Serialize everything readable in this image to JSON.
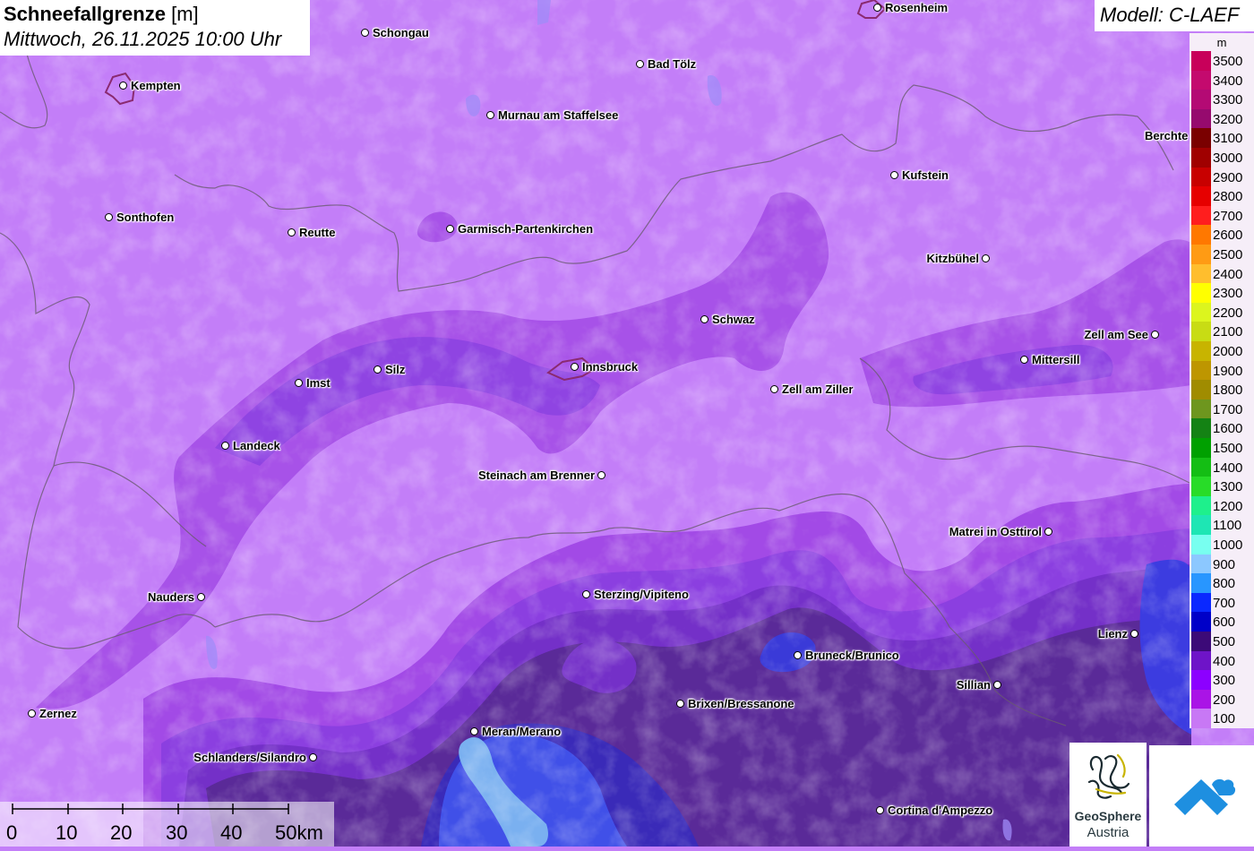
{
  "title": {
    "main": "Schneefallgrenze",
    "unit": "[m]",
    "datetime": "Mittwoch, 26.11.2025 10:00 Uhr"
  },
  "model": "Modell: C-LAEF",
  "legend": {
    "unit": "m",
    "levels": [
      {
        "label": "3500",
        "color": "#c8005a"
      },
      {
        "label": "3400",
        "color": "#c40a6e"
      },
      {
        "label": "3300",
        "color": "#b40a74"
      },
      {
        "label": "3200",
        "color": "#960a6e"
      },
      {
        "label": "3100",
        "color": "#7a0000"
      },
      {
        "label": "3000",
        "color": "#a00000"
      },
      {
        "label": "2900",
        "color": "#c80000"
      },
      {
        "label": "2800",
        "color": "#e60000"
      },
      {
        "label": "2700",
        "color": "#ff1e1e"
      },
      {
        "label": "2600",
        "color": "#ff7800"
      },
      {
        "label": "2500",
        "color": "#ff9b14"
      },
      {
        "label": "2400",
        "color": "#ffbe2d"
      },
      {
        "label": "2300",
        "color": "#ffff00"
      },
      {
        "label": "2200",
        "color": "#dcf51e"
      },
      {
        "label": "2100",
        "color": "#c8dc14"
      },
      {
        "label": "2000",
        "color": "#c8b400"
      },
      {
        "label": "1900",
        "color": "#be9600"
      },
      {
        "label": "1800",
        "color": "#a08c00"
      },
      {
        "label": "1700",
        "color": "#6e961e"
      },
      {
        "label": "1600",
        "color": "#148214"
      },
      {
        "label": "1500",
        "color": "#00a000"
      },
      {
        "label": "1400",
        "color": "#14be14"
      },
      {
        "label": "1300",
        "color": "#28dc28"
      },
      {
        "label": "1200",
        "color": "#1ef08c"
      },
      {
        "label": "1100",
        "color": "#1ee6b4"
      },
      {
        "label": "1000",
        "color": "#78fff0"
      },
      {
        "label": "900",
        "color": "#8cc8ff"
      },
      {
        "label": "800",
        "color": "#2896ff"
      },
      {
        "label": "700",
        "color": "#0a28ff"
      },
      {
        "label": "600",
        "color": "#0000c8"
      },
      {
        "label": "500",
        "color": "#3c0a78"
      },
      {
        "label": "400",
        "color": "#6e14c8"
      },
      {
        "label": "300",
        "color": "#8c00ff"
      },
      {
        "label": "200",
        "color": "#aa14e6"
      },
      {
        "label": "100",
        "color": "#c878f5"
      }
    ]
  },
  "places": [
    {
      "name": "Rosenheim"
    },
    {
      "name": "Schongau"
    },
    {
      "name": "Kempten"
    },
    {
      "name": "Bad Tölz"
    },
    {
      "name": "Murnau am Staffelsee"
    },
    {
      "name": "Berchte"
    },
    {
      "name": "Kufstein"
    },
    {
      "name": "Sonthofen"
    },
    {
      "name": "Reutte"
    },
    {
      "name": "Garmisch-Partenkirchen"
    },
    {
      "name": "Kitzbühel"
    },
    {
      "name": "Schwaz"
    },
    {
      "name": "Zell am See"
    },
    {
      "name": "Mittersill"
    },
    {
      "name": "Imst"
    },
    {
      "name": "Silz"
    },
    {
      "name": "Innsbruck"
    },
    {
      "name": "Zell am Ziller"
    },
    {
      "name": "Landeck"
    },
    {
      "name": "Steinach am Brenner"
    },
    {
      "name": "Matrei in Osttirol"
    },
    {
      "name": "Nauders"
    },
    {
      "name": "Sterzing/Vipiteno"
    },
    {
      "name": "Lienz"
    },
    {
      "name": "Bruneck/Brunico"
    },
    {
      "name": "Sillian"
    },
    {
      "name": "Brixen/Bressanone"
    },
    {
      "name": "Zernez"
    },
    {
      "name": "Meran/Merano"
    },
    {
      "name": "Schlanders/Silandro"
    },
    {
      "name": "Cortina d'Ampezzo"
    }
  ],
  "scale": {
    "labels": [
      "0",
      "10",
      "20",
      "30",
      "40",
      "50km"
    ]
  },
  "logo": {
    "name": "GeoSphere",
    "sub": "Austria"
  },
  "colors": {
    "base": "#c37ef8",
    "band200": "#a24ae6",
    "band300": "#8a3ce0",
    "band400": "#7a2ccc",
    "band500": "#5a2a9a",
    "band600": "#3a2ab8",
    "band700": "#4050e8",
    "band900": "#7ab0f0"
  }
}
